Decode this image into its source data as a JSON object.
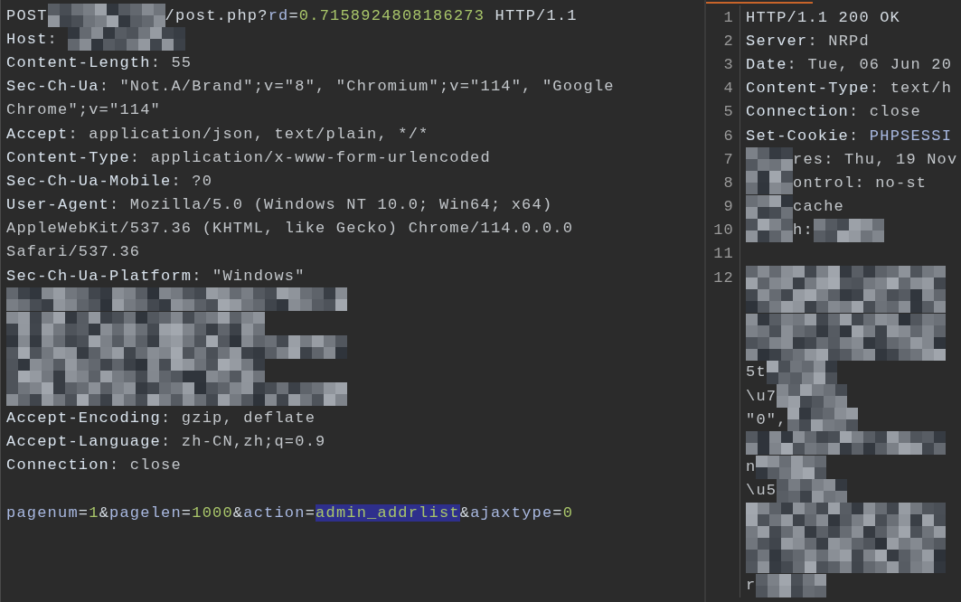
{
  "request": {
    "lines": [
      {
        "segments": [
          {
            "kind": "plain",
            "text": "POST"
          },
          {
            "kind": "redacted"
          },
          {
            "kind": "plain",
            "text": "/post.php?"
          },
          {
            "kind": "param",
            "text": "rd"
          },
          {
            "kind": "plain",
            "text": "="
          },
          {
            "kind": "num",
            "text": "0.7158924808186273"
          },
          {
            "kind": "plain",
            "text": " HTTP/1.1"
          }
        ]
      },
      {
        "segments": [
          {
            "kind": "key",
            "text": "Host"
          },
          {
            "kind": "val",
            "text": ": "
          },
          {
            "kind": "redacted"
          }
        ]
      },
      {
        "segments": [
          {
            "kind": "key",
            "text": "Content-Length"
          },
          {
            "kind": "val",
            "text": ": 55"
          }
        ]
      },
      {
        "segments": [
          {
            "kind": "key",
            "text": "Sec-Ch-Ua"
          },
          {
            "kind": "val",
            "text": ": \"Not.A/Brand\";v=\"8\", \"Chromium\";v=\"114\", \"Google"
          }
        ]
      },
      {
        "segments": [
          {
            "kind": "val",
            "text": "Chrome\";v=\"114\""
          }
        ]
      },
      {
        "segments": [
          {
            "kind": "key",
            "text": "Accept"
          },
          {
            "kind": "val",
            "text": ": application/json, text/plain, */*"
          }
        ]
      },
      {
        "segments": [
          {
            "kind": "key",
            "text": "Content-Type"
          },
          {
            "kind": "val",
            "text": ": application/x-www-form-urlencoded"
          }
        ]
      },
      {
        "segments": [
          {
            "kind": "key",
            "text": "Sec-Ch-Ua-Mobile"
          },
          {
            "kind": "val",
            "text": ": ?0"
          }
        ]
      },
      {
        "segments": [
          {
            "kind": "key",
            "text": "User-Agent"
          },
          {
            "kind": "val",
            "text": ": Mozilla/5.0 (Windows NT 10.0; Win64; x64)"
          }
        ]
      },
      {
        "segments": [
          {
            "kind": "val",
            "text": "AppleWebKit/537.36 (KHTML, like Gecko) Chrome/114.0.0.0"
          }
        ]
      },
      {
        "segments": [
          {
            "kind": "val",
            "text": "Safari/537.36"
          }
        ]
      },
      {
        "segments": [
          {
            "kind": "key",
            "text": "Sec-Ch-Ua-Platform"
          },
          {
            "kind": "val",
            "text": ": \"Windows\""
          }
        ]
      },
      {
        "segments": [
          {
            "kind": "redacted"
          }
        ]
      },
      {
        "segments": [
          {
            "kind": "redacted"
          }
        ]
      },
      {
        "segments": [
          {
            "kind": "redacted"
          }
        ]
      },
      {
        "segments": [
          {
            "kind": "redacted"
          }
        ]
      },
      {
        "segments": [
          {
            "kind": "redacted"
          }
        ]
      },
      {
        "segments": [
          {
            "kind": "key",
            "text": "Accept-Encoding"
          },
          {
            "kind": "val",
            "text": ": gzip, deflate"
          }
        ]
      },
      {
        "segments": [
          {
            "kind": "key",
            "text": "Accept-Language"
          },
          {
            "kind": "val",
            "text": ": zh-CN,zh;q=0.9"
          }
        ]
      },
      {
        "segments": [
          {
            "kind": "key",
            "text": "Connection"
          },
          {
            "kind": "val",
            "text": ": close"
          }
        ]
      },
      {
        "kind": "body",
        "segments": [
          {
            "kind": "param",
            "text": "pagenum"
          },
          {
            "kind": "plain",
            "text": "="
          },
          {
            "kind": "num",
            "text": "1"
          },
          {
            "kind": "plain",
            "text": "&"
          },
          {
            "kind": "param",
            "text": "pagelen"
          },
          {
            "kind": "plain",
            "text": "="
          },
          {
            "kind": "num",
            "text": "1000"
          },
          {
            "kind": "plain",
            "text": "&"
          },
          {
            "kind": "param",
            "text": "action"
          },
          {
            "kind": "plain",
            "text": "="
          },
          {
            "kind": "selected",
            "text": "admin_addrlist"
          },
          {
            "kind": "plain",
            "text": "&"
          },
          {
            "kind": "param",
            "text": "ajaxtype"
          },
          {
            "kind": "plain",
            "text": "="
          },
          {
            "kind": "num",
            "text": "0"
          }
        ]
      }
    ]
  },
  "response": {
    "lines": [
      {
        "number": "1",
        "segments": [
          {
            "kind": "plain",
            "text": "HTTP/1.1 200 OK"
          }
        ]
      },
      {
        "number": "2",
        "segments": [
          {
            "kind": "key",
            "text": "Server"
          },
          {
            "kind": "val",
            "text": ": NRPd"
          }
        ]
      },
      {
        "number": "3",
        "segments": [
          {
            "kind": "key",
            "text": "Date"
          },
          {
            "kind": "val",
            "text": ": Tue, 06 Jun 20"
          }
        ]
      },
      {
        "number": "4",
        "segments": [
          {
            "kind": "key",
            "text": "Content-Type"
          },
          {
            "kind": "val",
            "text": ": text/h"
          }
        ]
      },
      {
        "number": "5",
        "segments": [
          {
            "kind": "key",
            "text": "Connection"
          },
          {
            "kind": "val",
            "text": ": close"
          }
        ]
      },
      {
        "number": "6",
        "segments": [
          {
            "kind": "key",
            "text": "Set-Cookie"
          },
          {
            "kind": "val",
            "text": ": "
          },
          {
            "kind": "param",
            "text": "PHPSESSI"
          }
        ]
      },
      {
        "number": "7",
        "segments": [
          {
            "kind": "redacted"
          },
          {
            "kind": "val",
            "text": "res: Thu, 19 Nov"
          }
        ]
      },
      {
        "number": "8",
        "segments": [
          {
            "kind": "redacted"
          },
          {
            "kind": "val",
            "text": "ontrol: no-st"
          }
        ]
      },
      {
        "number": "9",
        "segments": [
          {
            "kind": "redacted"
          },
          {
            "kind": "val",
            "text": "cache"
          }
        ]
      },
      {
        "number": "10",
        "segments": [
          {
            "kind": "redacted"
          },
          {
            "kind": "val",
            "text": "h:"
          },
          {
            "kind": "redacted"
          }
        ]
      },
      {
        "number": "11"
      },
      {
        "number": "12",
        "segments": [
          {
            "kind": "redacted"
          }
        ]
      },
      {
        "segments": [
          {
            "kind": "redacted"
          }
        ]
      },
      {
        "segments": [
          {
            "kind": "redacted"
          }
        ]
      },
      {
        "segments": [
          {
            "kind": "redacted"
          }
        ]
      },
      {
        "segments": [
          {
            "kind": "val",
            "text": "5t"
          },
          {
            "kind": "redacted"
          }
        ]
      },
      {
        "segments": [
          {
            "kind": "val",
            "text": "\\u7"
          },
          {
            "kind": "redacted"
          }
        ]
      },
      {
        "segments": [
          {
            "kind": "val",
            "text": "\"0\","
          },
          {
            "kind": "redacted"
          }
        ]
      },
      {
        "segments": [
          {
            "kind": "redacted"
          }
        ]
      },
      {
        "segments": [
          {
            "kind": "val",
            "text": "n"
          },
          {
            "kind": "redacted"
          }
        ]
      },
      {
        "segments": [
          {
            "kind": "val",
            "text": "\\u5"
          },
          {
            "kind": "redacted"
          }
        ]
      },
      {
        "segments": [
          {
            "kind": "redacted"
          }
        ]
      },
      {
        "segments": [
          {
            "kind": "redacted"
          }
        ]
      },
      {
        "segments": [
          {
            "kind": "redacted"
          }
        ]
      },
      {
        "segments": [
          {
            "kind": "val",
            "text": "r"
          },
          {
            "kind": "redacted"
          }
        ]
      }
    ]
  }
}
